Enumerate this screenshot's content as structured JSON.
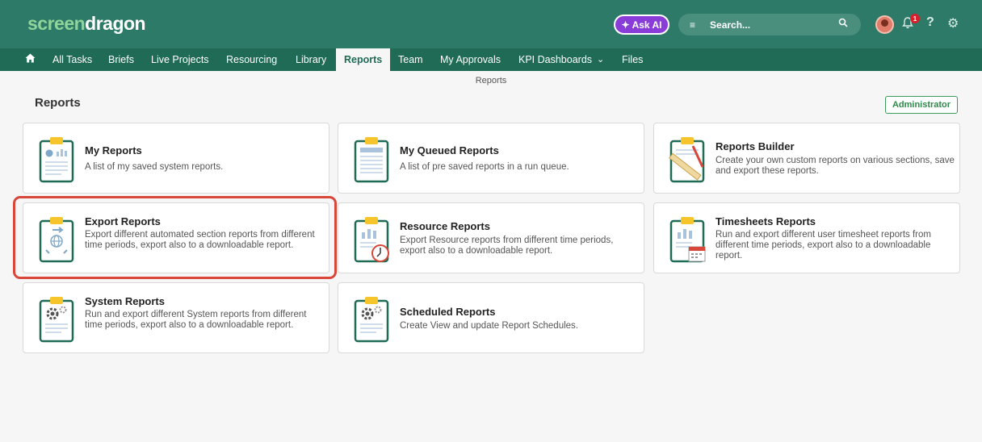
{
  "header": {
    "logo_part1": "screen",
    "logo_part2": "dragon",
    "askai_label": "Ask AI",
    "search_placeholder": "Search...",
    "notification_count": "1",
    "help_label": "?"
  },
  "nav": {
    "items": [
      "All Tasks",
      "Briefs",
      "Live Projects",
      "Resourcing",
      "Library",
      "Reports",
      "Team",
      "My Approvals",
      "KPI Dashboards",
      "Files"
    ],
    "active": "Reports",
    "kpi_chevron": "⌄"
  },
  "breadcrumb": "Reports",
  "page": {
    "title": "Reports",
    "admin_button": "Administrator"
  },
  "cards": [
    {
      "title": "My Reports",
      "description": "A list of my saved system reports.",
      "icon": "my-reports-icon"
    },
    {
      "title": "My Queued Reports",
      "description": "A list of pre saved reports in a run queue.",
      "icon": "queued-reports-icon"
    },
    {
      "title": "Reports Builder",
      "description": "Create your own custom reports on various sections, save and export these reports.",
      "icon": "reports-builder-icon"
    },
    {
      "title": "Export Reports",
      "description": "Export different automated section reports from different time periods, export also to a downloadable report.",
      "icon": "export-reports-icon"
    },
    {
      "title": "Resource Reports",
      "description": "Export Resource reports from different time periods, export also to a downloadable report.",
      "icon": "resource-reports-icon"
    },
    {
      "title": "Timesheets Reports",
      "description": "Run and export different user timesheet reports from different time periods, export also to a downloadable report.",
      "icon": "timesheets-reports-icon"
    },
    {
      "title": "System Reports",
      "description": "Run and export different System reports from different time periods, export also to a downloadable report.",
      "icon": "system-reports-icon"
    },
    {
      "title": "Scheduled Reports",
      "description": "Create View and update Report Schedules.",
      "icon": "scheduled-reports-icon"
    }
  ],
  "colors": {
    "header_bg": "#2c7a67",
    "nav_bg": "#1f6b55",
    "accent_green": "#3a9c5a",
    "highlight_red": "#d9473a",
    "askai_purple": "#8a3cd9"
  }
}
